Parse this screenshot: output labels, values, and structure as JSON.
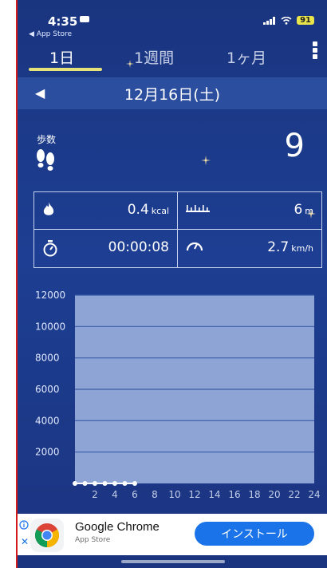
{
  "status": {
    "time": "4:35",
    "back_label": "◀ App Store",
    "battery": "91"
  },
  "tabs": [
    {
      "label": "1日",
      "active": true
    },
    {
      "label": "1週間",
      "active": false
    },
    {
      "label": "1ヶ月",
      "active": false
    }
  ],
  "date": {
    "prev_symbol": "◀",
    "text": "12月16日(土)"
  },
  "steps": {
    "label": "歩数",
    "value": "9"
  },
  "stats": {
    "calories": {
      "value": "0.4",
      "unit": "kcal"
    },
    "distance": {
      "value": "6",
      "unit": "m"
    },
    "time": {
      "value": "00:00:08"
    },
    "speed": {
      "value": "2.7",
      "unit": "km/h"
    }
  },
  "chart_data": {
    "type": "line",
    "ylim": [
      0,
      12000
    ],
    "y_ticks": [
      "2000",
      "4000",
      "6000",
      "8000",
      "10000",
      "12000"
    ],
    "x_tick_labels": [
      "2",
      "4",
      "6",
      "8",
      "10",
      "12",
      "14",
      "16",
      "18",
      "20",
      "22",
      "24"
    ],
    "x": [
      0,
      1,
      2,
      3,
      4,
      5,
      6
    ],
    "y": [
      0,
      0,
      0,
      0,
      0,
      0,
      0
    ]
  },
  "ad": {
    "title": "Google Chrome",
    "subtitle": "App Store",
    "install_label": "インストール",
    "close_symbol": "✕"
  },
  "colors": {
    "background": "#1d3e92",
    "accent_underline": "#e6e27a",
    "install_button": "#1a73e8"
  }
}
